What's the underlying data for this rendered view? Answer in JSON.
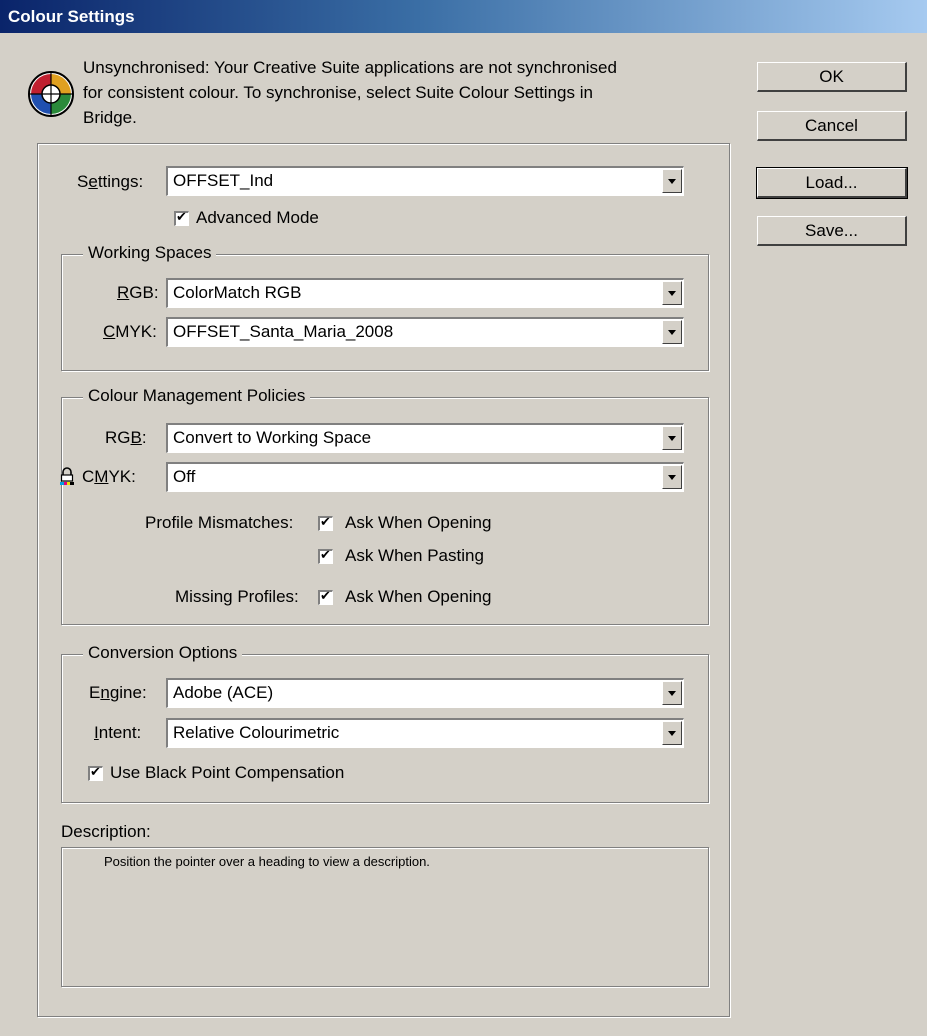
{
  "window": {
    "title": "Colour Settings"
  },
  "sync": {
    "icon": "colour-sync-icon",
    "message_line1": "Unsynchronised: Your Creative Suite applications are not synchronised",
    "message_line2": "for consistent colour. To synchronise, select Suite Colour Settings in",
    "message_line3": "Bridge."
  },
  "buttons": {
    "ok": "OK",
    "cancel": "Cancel",
    "load": "Load...",
    "save": "Save..."
  },
  "settings": {
    "label_pre": "S",
    "label_u": "e",
    "label_post": "ttings:",
    "value": "OFFSET_Ind",
    "advanced_mode_label": "Advanced Mode",
    "advanced_mode_checked": true
  },
  "working_spaces": {
    "title": "Working Spaces",
    "rgb_label_u": "R",
    "rgb_label_post": "GB:",
    "rgb_value": "ColorMatch RGB",
    "cmyk_label_u": "C",
    "cmyk_label_post": "MYK:",
    "cmyk_value": "OFFSET_Santa_Maria_2008"
  },
  "policies": {
    "title": "Colour Management Policies",
    "rgb_label_pre": "RG",
    "rgb_label_u": "B",
    "rgb_label_post": ":",
    "rgb_value": "Convert to Working Space",
    "cmyk_label_pre": "C",
    "cmyk_label_u": "M",
    "cmyk_label_post": "YK:",
    "cmyk_value": "Off",
    "lock_icon": "lock-icon",
    "profile_mismatches_label": "Profile Mismatches:",
    "ask_opening_label": "Ask When Opening",
    "ask_pasting_label": "Ask When Pasting",
    "missing_profiles_label": "Missing Profiles:",
    "missing_ask_opening_label": "Ask When Opening"
  },
  "conversion": {
    "title": "Conversion Options",
    "engine_label_pre": "E",
    "engine_label_u": "n",
    "engine_label_post": "gine:",
    "engine_value": "Adobe (ACE)",
    "intent_label_u": "I",
    "intent_label_post": "ntent:",
    "intent_value": "Relative Colourimetric",
    "bpc_label": "Use Black Point Compensation"
  },
  "description": {
    "label": "Description:",
    "text": "Position the pointer over a heading to view a description."
  },
  "colors": {
    "titlebar_start": "#0a246a",
    "titlebar_end": "#a6caf0",
    "dialog_bg": "#d4d0c8"
  }
}
